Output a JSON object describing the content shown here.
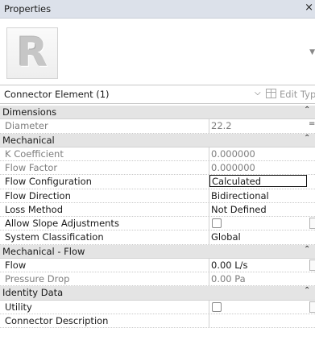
{
  "window": {
    "title": "Properties",
    "close_glyph": "×"
  },
  "type_preview": {
    "letter": "R",
    "arrow": "▼"
  },
  "selector": {
    "label": "Connector Element (1)",
    "chevron": "⌵",
    "edit_type_label": "Edit Type"
  },
  "categories": [
    {
      "label": "Dimensions",
      "collapse_glyph": "⌃",
      "rows": [
        {
          "name": "Diameter",
          "value": "22.2",
          "kind": "readonly",
          "stub": "="
        }
      ]
    },
    {
      "label": "Mechanical",
      "collapse_glyph": "⌃",
      "rows": [
        {
          "name": "K Coefficient",
          "value": "0.000000",
          "kind": "readonly"
        },
        {
          "name": "Flow Factor",
          "value": "0.000000",
          "kind": "readonly"
        },
        {
          "name": "Flow Configuration",
          "value": "Calculated",
          "kind": "editing"
        },
        {
          "name": "Flow Direction",
          "value": "Bidirectional",
          "kind": "text"
        },
        {
          "name": "Loss Method",
          "value": "Not Defined",
          "kind": "text"
        },
        {
          "name": "Allow Slope Adjustments",
          "value": false,
          "kind": "checkbox",
          "stub": "button"
        },
        {
          "name": "System Classification",
          "value": "Global",
          "kind": "text"
        }
      ]
    },
    {
      "label": "Mechanical - Flow",
      "collapse_glyph": "⌃",
      "rows": [
        {
          "name": "Flow",
          "value": "0.00 L/s",
          "kind": "text",
          "stub": "button"
        },
        {
          "name": "Pressure Drop",
          "value": "0.00 Pa",
          "kind": "readonly"
        }
      ]
    },
    {
      "label": "Identity Data",
      "collapse_glyph": "⌃",
      "rows": [
        {
          "name": "Utility",
          "value": false,
          "kind": "checkbox",
          "stub": "button"
        },
        {
          "name": "Connector Description",
          "value": "",
          "kind": "text"
        }
      ]
    }
  ]
}
